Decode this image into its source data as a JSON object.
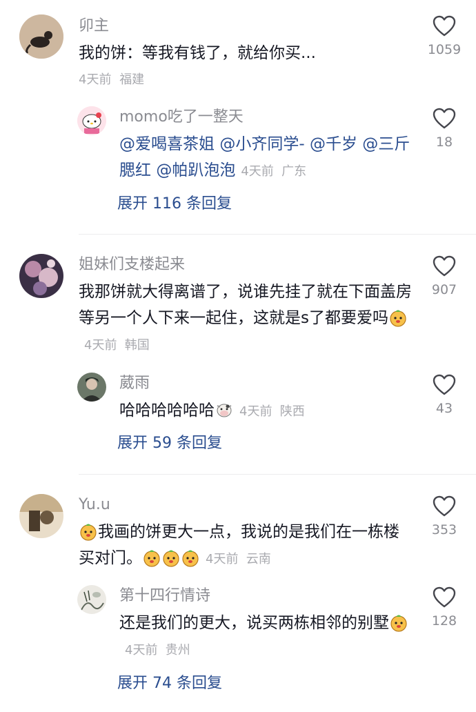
{
  "threads": [
    {
      "comment": {
        "author": "卯主",
        "text": "我的饼：等我有钱了，就给你买...",
        "time": "4天前",
        "location": "福建",
        "likes": "1059"
      },
      "reply": {
        "author": "momo吃了一整天",
        "mentions": [
          "@爱喝喜茶姐",
          "@小齐同学-",
          "@千岁",
          "@三斤腮红",
          "@帕趴泡泡"
        ],
        "time": "4天前",
        "location": "广东",
        "likes": "18"
      },
      "expand_label": "展开 116 条回复"
    },
    {
      "comment": {
        "author": "姐妹们支楼起来",
        "text": "我那饼就大得离谱了，说谁先挂了就在下面盖房等另一个人下来一起住，这就是s了都要爱吗",
        "time": "4天前",
        "location": "韩国",
        "likes": "907"
      },
      "reply": {
        "author": "葳雨",
        "text": "哈哈哈哈哈哈",
        "time": "4天前",
        "location": "陕西",
        "likes": "43"
      },
      "expand_label": "展开 59 条回复"
    },
    {
      "comment": {
        "author": "Yu.u",
        "text": "我画的饼更大一点，我说的是我们在一栋楼买对门。",
        "time": "4天前",
        "location": "云南",
        "likes": "353"
      },
      "reply": {
        "author": "第十四行情诗",
        "text": "还是我们的更大，说买两栋相邻的别墅",
        "time": "4天前",
        "location": "贵州",
        "likes": "128"
      },
      "expand_label": "展开 74 条回复"
    }
  ],
  "icons": {
    "like": "heart-outline-icon",
    "emoji_peach": "peach-face-emoji",
    "emoji_cow": "cow-face-emoji"
  },
  "colors": {
    "text": "#161823",
    "secondary": "#8a8b91",
    "meta": "#a9aaaf",
    "link": "#2a4d8f"
  }
}
